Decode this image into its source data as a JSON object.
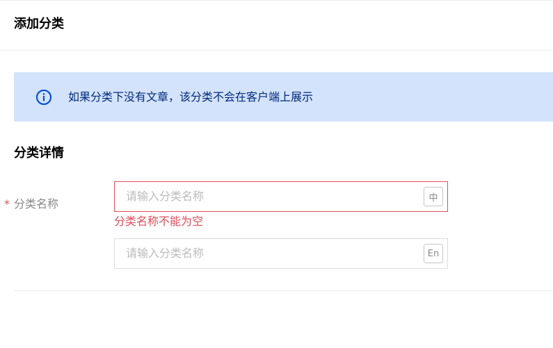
{
  "header": {
    "title": "添加分类"
  },
  "alert": {
    "icon": "info-icon",
    "text": "如果分类下没有文章，该分类不会在客户端上展示",
    "icon_color": "#0052d9",
    "background": "#d4e3fc"
  },
  "section": {
    "title": "分类详情"
  },
  "form": {
    "label_required_mark": "*",
    "label": "分类名称",
    "input_zh": {
      "placeholder": "请输入分类名称",
      "lang_badge": "中",
      "value": ""
    },
    "error": "分类名称不能为空",
    "input_en": {
      "placeholder": "请输入分类名称",
      "lang_badge": "En",
      "value": ""
    }
  },
  "colors": {
    "error": "#e34d59",
    "border": "#dcdcdc",
    "placeholder": "#bbbbbb"
  }
}
